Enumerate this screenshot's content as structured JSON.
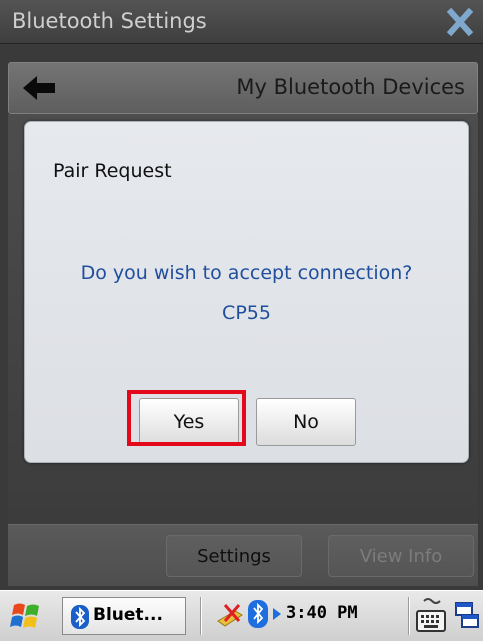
{
  "window": {
    "title": "Bluetooth Settings"
  },
  "nav": {
    "title": "My Bluetooth Devices"
  },
  "dialog": {
    "title": "Pair Request",
    "message": "Do you wish to accept connection?",
    "device": "CP55",
    "yes_label": "Yes",
    "no_label": "No"
  },
  "bottom": {
    "settings_label": "Settings",
    "view_info_label": "View Info"
  },
  "taskbar": {
    "task_label": "Bluet...",
    "clock": "3:40 PM"
  },
  "colors": {
    "message_text": "#1f4f9c",
    "highlight": "#e3081a"
  }
}
